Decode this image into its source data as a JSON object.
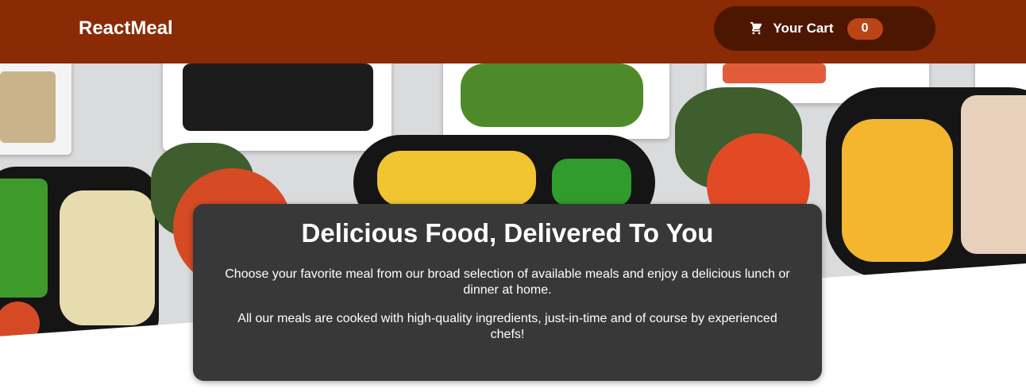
{
  "header": {
    "logo": "ReactMeal",
    "cart": {
      "label": "Your Cart",
      "count": "0",
      "icon": "cart-icon"
    }
  },
  "summary": {
    "title": "Delicious Food, Delivered To You",
    "paragraphs": [
      "Choose your favorite meal from our broad selection of available meals and enjoy a delicious lunch or dinner at home.",
      "All our meals are cooked with high-quality ingredients, just-in-time and of course by experienced chefs!"
    ]
  },
  "colors": {
    "header": "#8a2b06",
    "cart_button": "#4d1601",
    "badge": "#b94517",
    "summary_bg": "#383838"
  }
}
